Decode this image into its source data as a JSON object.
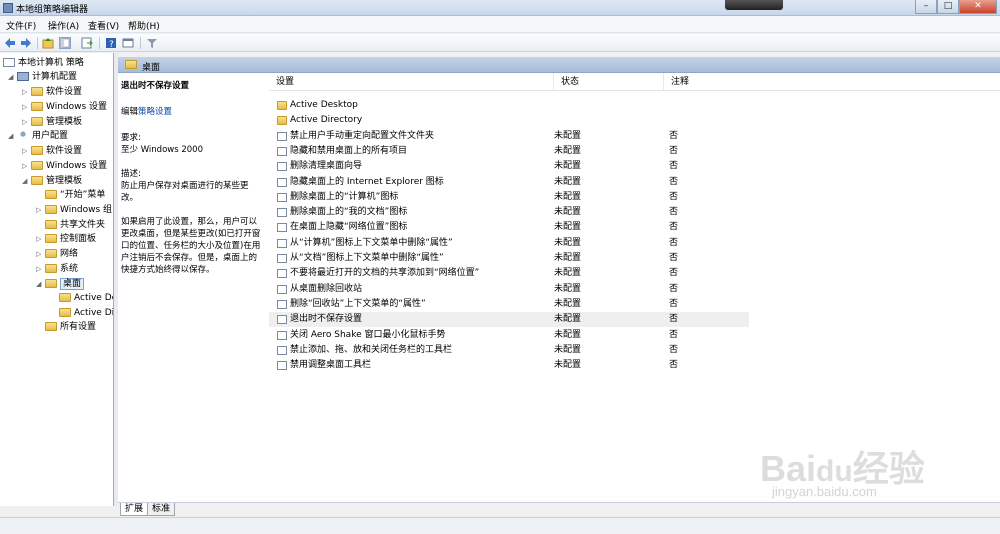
{
  "window": {
    "title": "本地组策略编辑器"
  },
  "menubar": {
    "file": "文件(F)",
    "action": "操作(A)",
    "view": "查看(V)",
    "help": "帮助(H)"
  },
  "tree": {
    "root": "本地计算机 策略",
    "computer_config": "计算机配置",
    "cc_software": "软件设置",
    "cc_windows": "Windows 设置",
    "cc_admin": "管理模板",
    "user_config": "用户配置",
    "uc_software": "软件设置",
    "uc_windows": "Windows 设置",
    "uc_admin": "管理模板",
    "start_menu": "“开始”菜单",
    "windows_components": "Windows 组",
    "shared_folders": "共享文件夹",
    "control_panel": "控制面板",
    "network": "网络",
    "system": "系统",
    "desktop": "桌面",
    "active_desktop": "Active De",
    "active_directory": "Active Di",
    "all_settings": "所有设置"
  },
  "header": {
    "title": "桌面"
  },
  "description": {
    "title": "退出时不保存设置",
    "edit_prefix": "编辑",
    "edit_link": "策略设置",
    "req_label": "要求:",
    "req_value": "至少 Windows 2000",
    "desc_label": "描述:",
    "desc_value": "防止用户保存对桌面进行的某些更改。",
    "detail": "如果启用了此设置，那么，用户可以更改桌面，但是某些更改(如已打开窗口的位置、任务栏的大小及位置)在用户注销后不会保存。但是，桌面上的快捷方式始终得以保存。"
  },
  "columns": {
    "setting": "设置",
    "state": "状态",
    "comment": "注释"
  },
  "rows": [
    {
      "name": "Active Desktop",
      "state": "",
      "comment": "",
      "type": "folder"
    },
    {
      "name": "Active Directory",
      "state": "",
      "comment": "",
      "type": "folder"
    },
    {
      "name": "禁止用户手动重定向配置文件文件夹",
      "state": "未配置",
      "comment": "否",
      "type": "policy"
    },
    {
      "name": "隐藏和禁用桌面上的所有项目",
      "state": "未配置",
      "comment": "否",
      "type": "policy"
    },
    {
      "name": "删除清理桌面向导",
      "state": "未配置",
      "comment": "否",
      "type": "policy"
    },
    {
      "name": "隐藏桌面上的 Internet Explorer 图标",
      "state": "未配置",
      "comment": "否",
      "type": "policy"
    },
    {
      "name": "删除桌面上的“计算机”图标",
      "state": "未配置",
      "comment": "否",
      "type": "policy"
    },
    {
      "name": "删除桌面上的“我的文档”图标",
      "state": "未配置",
      "comment": "否",
      "type": "policy"
    },
    {
      "name": "在桌面上隐藏“网络位置”图标",
      "state": "未配置",
      "comment": "否",
      "type": "policy"
    },
    {
      "name": "从“计算机”图标上下文菜单中删除“属性”",
      "state": "未配置",
      "comment": "否",
      "type": "policy"
    },
    {
      "name": "从“文档”图标上下文菜单中删除“属性”",
      "state": "未配置",
      "comment": "否",
      "type": "policy"
    },
    {
      "name": "不要将最近打开的文档的共享添加到“网络位置”",
      "state": "未配置",
      "comment": "否",
      "type": "policy"
    },
    {
      "name": "从桌面删除回收站",
      "state": "未配置",
      "comment": "否",
      "type": "policy"
    },
    {
      "name": "删除“回收站”上下文菜单的“属性”",
      "state": "未配置",
      "comment": "否",
      "type": "policy"
    },
    {
      "name": "退出时不保存设置",
      "state": "未配置",
      "comment": "否",
      "type": "policy",
      "selected": true
    },
    {
      "name": "关闭 Aero Shake 窗口最小化鼠标手势",
      "state": "未配置",
      "comment": "否",
      "type": "policy"
    },
    {
      "name": "禁止添加、拖、放和关闭任务栏的工具栏",
      "state": "未配置",
      "comment": "否",
      "type": "policy"
    },
    {
      "name": "禁用调整桌面工具栏",
      "state": "未配置",
      "comment": "否",
      "type": "policy"
    }
  ],
  "tabs": {
    "extended": "扩展",
    "standard": "标准"
  },
  "watermark": {
    "brand": "Baidu经验",
    "url": "jingyan.baidu.com"
  }
}
